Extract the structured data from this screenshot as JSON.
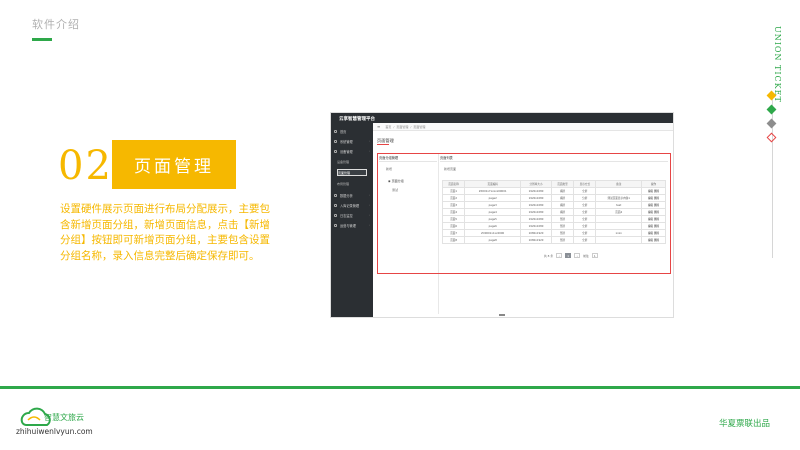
{
  "slide": {
    "title": "软件介绍",
    "brand_vertical": "UNION TICKET",
    "section_number": "02",
    "section_title": "页面管理",
    "description": "设置硬件展示页面进行布局分配展示，主要包含新增页面分组，新增页面信息，点击【新增分组】按钮即可新增页面分组，主要包含设置分组名称，录入信息完整后确定保存即可。",
    "footer_credit": "华夏票联出品",
    "logo_name": "智慧文旅云",
    "logo_url": "zhihuiwenlvyun.com",
    "colors": {
      "accent_yellow": "#f6b800",
      "brand_green": "#2ea84a",
      "highlight_red": "#e64545",
      "sidebar_dark": "#2b2f33"
    }
  },
  "app": {
    "title": "云享智慧管理平台",
    "sidebar": [
      {
        "label": "首页",
        "icon": "home-icon"
      },
      {
        "label": "系统管理",
        "icon": "gear-icon"
      },
      {
        "label": "设备管理",
        "icon": "device-icon"
      },
      {
        "label": "设备管理",
        "icon": "dot",
        "sub": true
      },
      {
        "label": "页面管理",
        "icon": "dot",
        "sub": true,
        "active": true
      },
      {
        "label": "布局管理",
        "icon": "dot",
        "sub": true
      },
      {
        "label": "数据分析",
        "icon": "chart-icon"
      },
      {
        "label": "入库记录管理",
        "icon": "list-icon"
      },
      {
        "label": "日志监控",
        "icon": "monitor-icon"
      },
      {
        "label": "运营与管理",
        "icon": "user-icon"
      }
    ],
    "breadcrumb": [
      "首页",
      "页面管理",
      "页面管理"
    ],
    "page_heading": "页面管理",
    "left_panel": {
      "title": "页面分组管理",
      "add_label": "新增",
      "tree_root": "页面分组",
      "tree_child": "测试"
    },
    "right_panel": {
      "title": "页面列表",
      "new_button": "新增页面"
    },
    "table": {
      "headers": [
        "页面名称",
        "页面编码",
        "分辨率大小",
        "页面类型",
        "显示方式",
        "备注",
        "操作"
      ],
      "rows": [
        [
          "页面1",
          "ZX001x7xxxxx00001",
          "1920x1080",
          "横屏",
          "全屏",
          "",
          "编辑 删除"
        ],
        [
          "页面2",
          "page2",
          "1920x1080",
          "横屏",
          "分屏",
          "测试页面显示内容1",
          "编辑 删除"
        ],
        [
          "页面3",
          "page3",
          "1920x1080",
          "横屏",
          "全屏",
          "test",
          "编辑 删除"
        ],
        [
          "页面4",
          "page4",
          "1920x1080",
          "横屏",
          "全屏",
          "页面4",
          "编辑 删除"
        ],
        [
          "页面5",
          "page5",
          "1920x1080",
          "竖屏",
          "全屏",
          "",
          "编辑 删除"
        ],
        [
          "页面6",
          "page6",
          "1920x1080",
          "竖屏",
          "全屏",
          "",
          "编辑 删除"
        ],
        [
          "页面7",
          "ZX0001x1xx0000",
          "1080x1920",
          "竖屏",
          "全屏",
          "xxxx",
          "编辑 删除"
        ],
        [
          "页面8",
          "page8",
          "1080x1920",
          "竖屏",
          "全屏",
          "",
          "编辑 删除"
        ]
      ]
    },
    "pager": {
      "total": "共 8 条",
      "current": "1",
      "goto_label": "前往",
      "goto_value": "1"
    }
  }
}
